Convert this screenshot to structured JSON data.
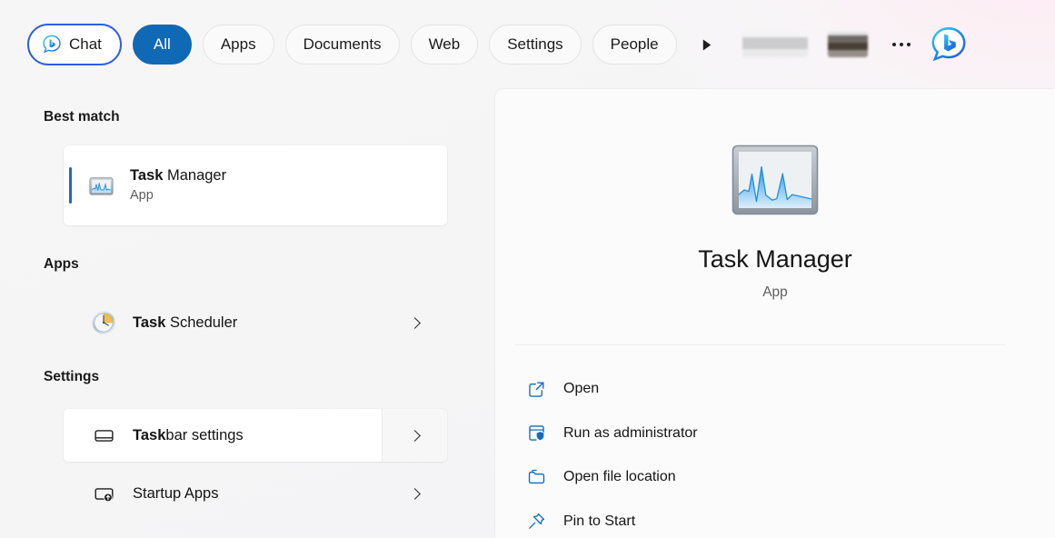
{
  "tabs": [
    {
      "label": "Chat",
      "icon": "bing-chat-icon",
      "state": "focused"
    },
    {
      "label": "All",
      "icon": null,
      "state": "selected"
    },
    {
      "label": "Apps",
      "icon": null,
      "state": "normal"
    },
    {
      "label": "Documents",
      "icon": null,
      "state": "normal"
    },
    {
      "label": "Web",
      "icon": null,
      "state": "normal"
    },
    {
      "label": "Settings",
      "icon": null,
      "state": "normal"
    },
    {
      "label": "People",
      "icon": null,
      "state": "normal"
    }
  ],
  "tabbar": {
    "next_icon": "play-arrow-icon",
    "overflow_icon": "more-options-icon",
    "account_icon": "bing-chat-logo",
    "redacted_1": "blurred-content",
    "redacted_2": "blurred-content"
  },
  "results": {
    "best_match": {
      "header": "Best match",
      "item": {
        "title_bold": "Task",
        "title_rest": " Manager",
        "subtitle": "App",
        "icon": "task-manager-icon",
        "selected": true
      }
    },
    "apps": {
      "header": "Apps",
      "items": [
        {
          "title_bold": "Task",
          "title_rest": " Scheduler",
          "icon": "task-scheduler-clock-icon",
          "chevron": "chevron-right-icon",
          "hovered": false
        }
      ]
    },
    "settings": {
      "header": "Settings",
      "items": [
        {
          "title_bold": "Task",
          "title_rest": "bar settings",
          "icon": "taskbar-icon",
          "chevron": "chevron-right-icon",
          "hovered": true
        },
        {
          "title_bold": "",
          "title_rest": "Startup Apps",
          "icon": "startup-apps-icon",
          "chevron": "chevron-right-icon",
          "hovered": false
        }
      ]
    }
  },
  "preview": {
    "icon": "task-manager-icon",
    "title": "Task Manager",
    "subtitle": "App",
    "actions": [
      {
        "label": "Open",
        "icon": "open-external-icon"
      },
      {
        "label": "Run as administrator",
        "icon": "shield-admin-icon"
      },
      {
        "label": "Open file location",
        "icon": "folder-icon"
      },
      {
        "label": "Pin to Start",
        "icon": "pin-icon"
      }
    ]
  },
  "colors": {
    "accent_blue": "#1069b4",
    "focus_ring": "#2f5fe0",
    "icon_blue": "#0f6cbd",
    "selection_bar": "#1d6bc4",
    "page_background": "#f5f5f6",
    "panel_background": "#fbfbfb"
  }
}
